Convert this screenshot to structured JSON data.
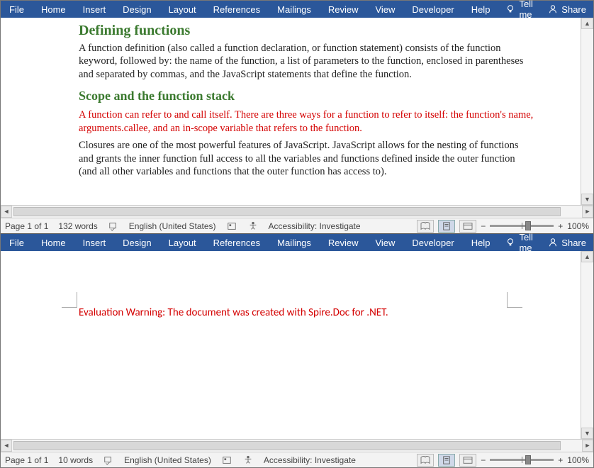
{
  "menu": {
    "file": "File",
    "home": "Home",
    "insert": "Insert",
    "design": "Design",
    "layout": "Layout",
    "references": "References",
    "mailings": "Mailings",
    "review": "Review",
    "view": "View",
    "developer": "Developer",
    "help": "Help",
    "tellme": "Tell me",
    "share": "Share"
  },
  "doc1": {
    "h1": "Defining functions",
    "p1": "A function definition (also called a function declaration, or function statement) consists of the function keyword, followed by: the name of the function, a list of parameters to the function, enclosed in parentheses and separated by commas, and the JavaScript statements that define the function.",
    "h2": "Scope and the function stack",
    "p2": "A function can refer to and call itself. There are three ways for a function to refer to itself: the function's name, arguments.callee, and an in-scope variable that refers to the function.",
    "p3": "Closures are one of the most powerful features of JavaScript. JavaScript allows for the nesting of functions and grants the inner function full access to all the variables and functions defined inside the outer function (and all other variables and functions that the outer function has access to)."
  },
  "doc2": {
    "warning": "Evaluation Warning: The document was created with Spire.Doc for .NET."
  },
  "status1": {
    "page": "Page 1 of 1",
    "words": "132 words",
    "lang": "English (United States)",
    "acc": "Accessibility: Investigate",
    "zoom": "100%"
  },
  "status2": {
    "page": "Page 1 of 1",
    "words": "10 words",
    "lang": "English (United States)",
    "acc": "Accessibility: Investigate",
    "zoom": "100%"
  },
  "sym": {
    "minus": "−",
    "plus": "+"
  }
}
